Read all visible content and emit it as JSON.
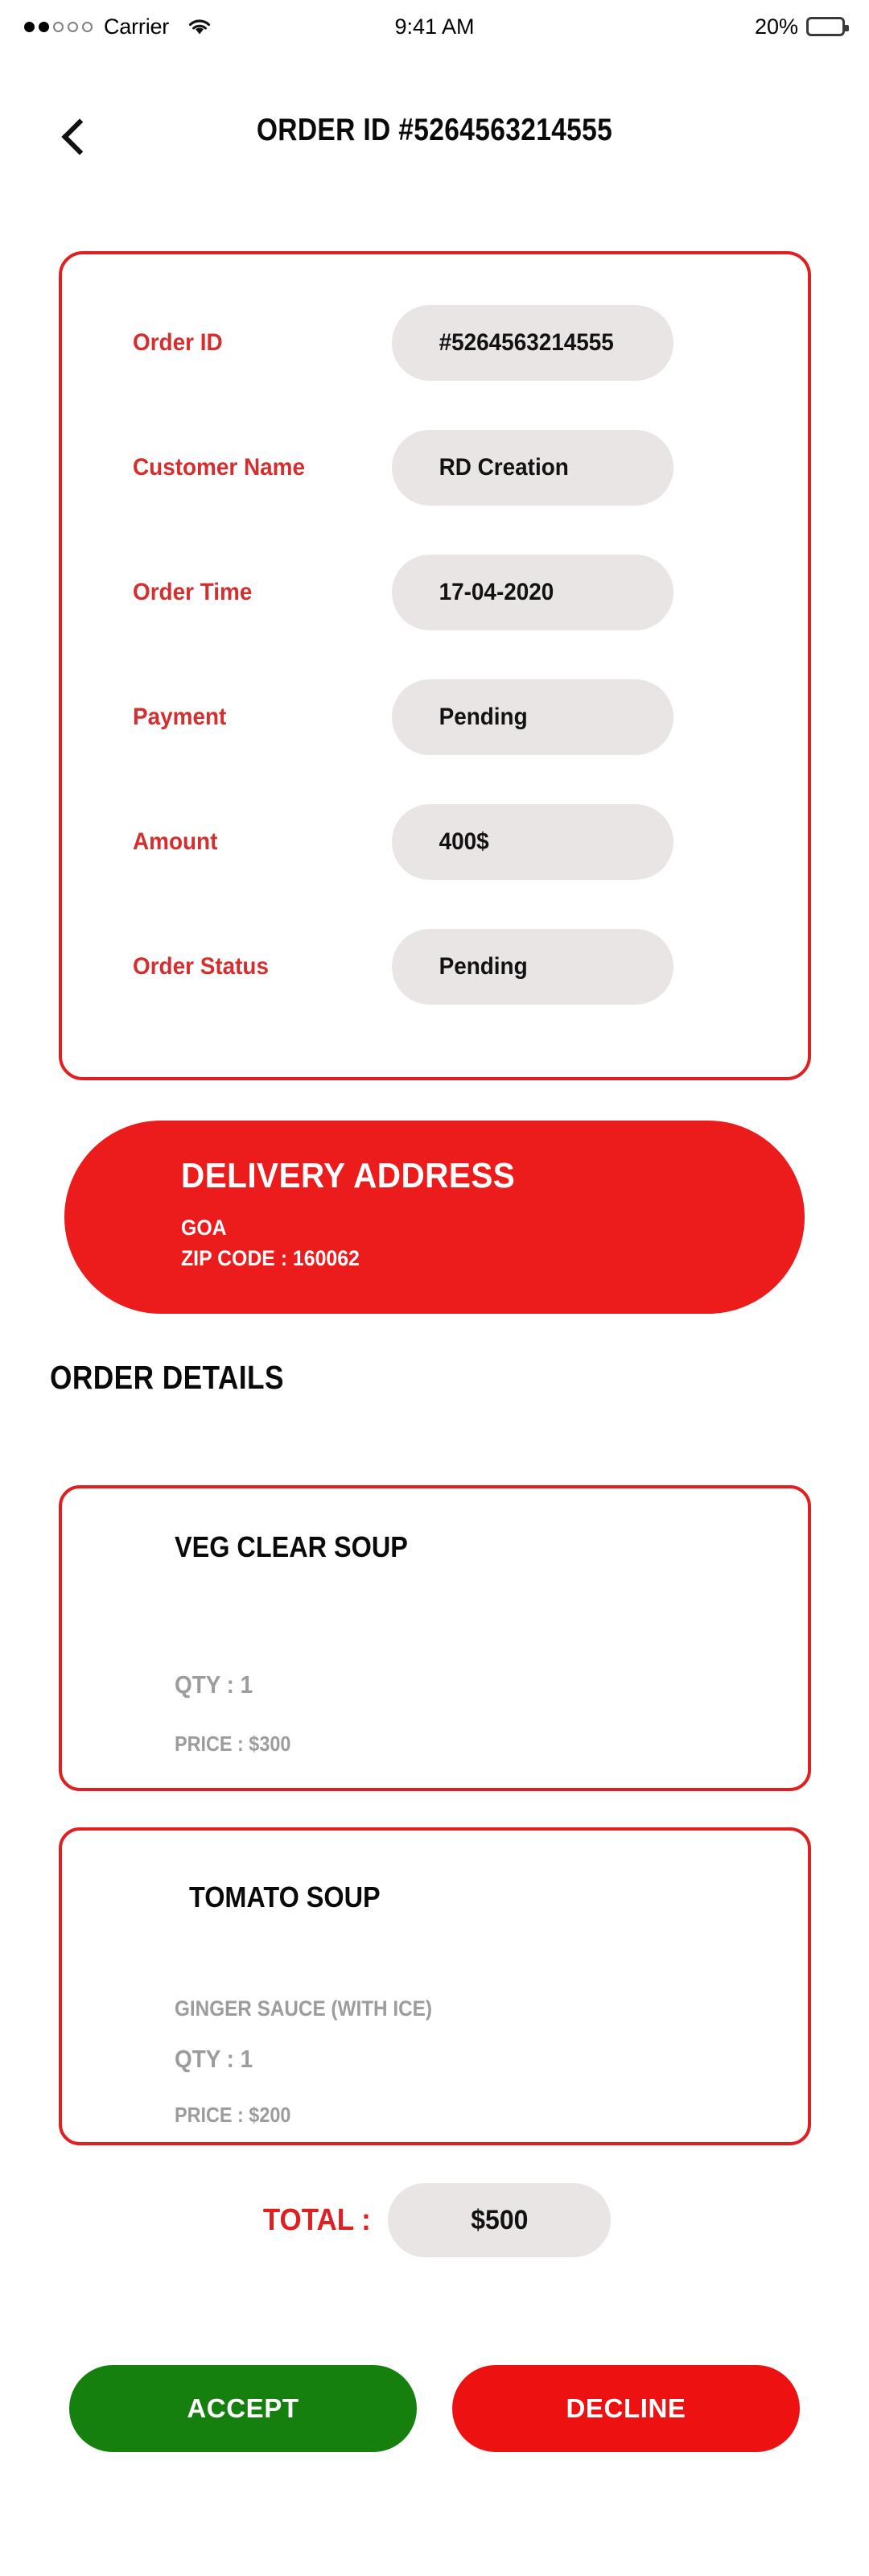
{
  "status_bar": {
    "carrier": "Carrier",
    "signal_dots": [
      "filled",
      "filled",
      "hollow",
      "hollow",
      "hollow"
    ],
    "wifi_icon": "wifi-icon",
    "time": "9:41 AM",
    "battery_percent": "20%",
    "battery_level": 20
  },
  "header": {
    "back_icon": "chevron-left-icon",
    "title": "ORDER ID #5264563214555"
  },
  "order_info": {
    "rows": [
      {
        "label": "Order ID",
        "value": "#5264563214555"
      },
      {
        "label": "Customer Name",
        "value": "RD Creation"
      },
      {
        "label": "Order Time",
        "value": "17-04-2020"
      },
      {
        "label": "Payment",
        "value": "Pending"
      },
      {
        "label": "Amount",
        "value": "400$"
      },
      {
        "label": "Order Status",
        "value": "Pending"
      }
    ]
  },
  "delivery": {
    "title": "DELIVERY ADDRESS",
    "city": "GOA",
    "zip": "ZIP CODE : 160062"
  },
  "order_details": {
    "heading": "ORDER DETAILS",
    "items": [
      {
        "name": "VEG CLEAR SOUP",
        "note": "",
        "qty": "QTY : 1",
        "price": "PRICE : $300"
      },
      {
        "name": "TOMATO SOUP",
        "note": "GINGER SAUCE (WITH ICE)",
        "qty": "QTY : 1",
        "price": "PRICE : $200"
      }
    ]
  },
  "total": {
    "label": "TOTAL :",
    "value": "$500"
  },
  "actions": {
    "accept_label": "ACCEPT",
    "decline_label": "DECLINE"
  },
  "colors": {
    "brand_red": "#ED1C1C",
    "card_border_red": "#E02020",
    "label_red": "#D42E2E",
    "accept_green": "#15800D",
    "decline_red": "#ED1111",
    "pill_grey": "#E9E5E5",
    "muted_text": "#9C9C9C"
  }
}
